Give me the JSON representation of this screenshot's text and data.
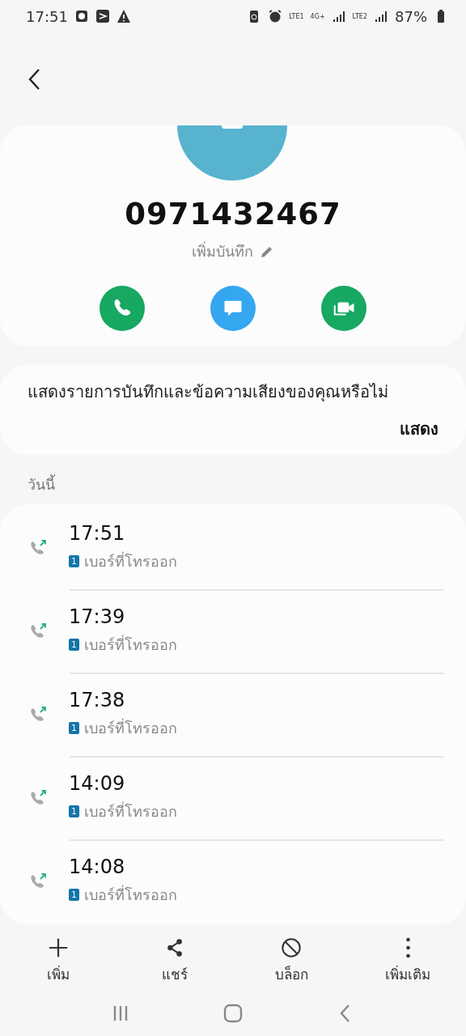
{
  "status_bar": {
    "time": "17:51",
    "network_1": "LTE1",
    "network_2": "4G+",
    "network_3": "LTE2",
    "battery": "87%"
  },
  "contact": {
    "number": "0971432467",
    "note_hint": "เพิ่มบันทึก"
  },
  "notice": {
    "text": "แสดงรายการบันทึกและข้อความเสียงของคุณหรือไม่",
    "action": "แสดง"
  },
  "section_label": "วันนี้",
  "calls": [
    {
      "time": "17:51",
      "sim": "1",
      "type": "เบอร์ที่โทรออก",
      "kind": "outgoing"
    },
    {
      "time": "17:39",
      "sim": "1",
      "type": "เบอร์ที่โทรออก",
      "kind": "outgoing"
    },
    {
      "time": "17:38",
      "sim": "1",
      "type": "เบอร์ที่โทรออก",
      "kind": "outgoing"
    },
    {
      "time": "14:09",
      "sim": "1",
      "type": "เบอร์ที่โทรออก",
      "kind": "outgoing"
    },
    {
      "time": "14:08",
      "sim": "1",
      "type": "เบอร์ที่โทรออก",
      "kind": "outgoing"
    }
  ],
  "actions": [
    {
      "label": "เพิ่ม",
      "kind": "add"
    },
    {
      "label": "แชร์",
      "kind": "share"
    },
    {
      "label": "บล็อก",
      "kind": "block"
    },
    {
      "label": "เพิ่มเติม",
      "kind": "more"
    }
  ]
}
